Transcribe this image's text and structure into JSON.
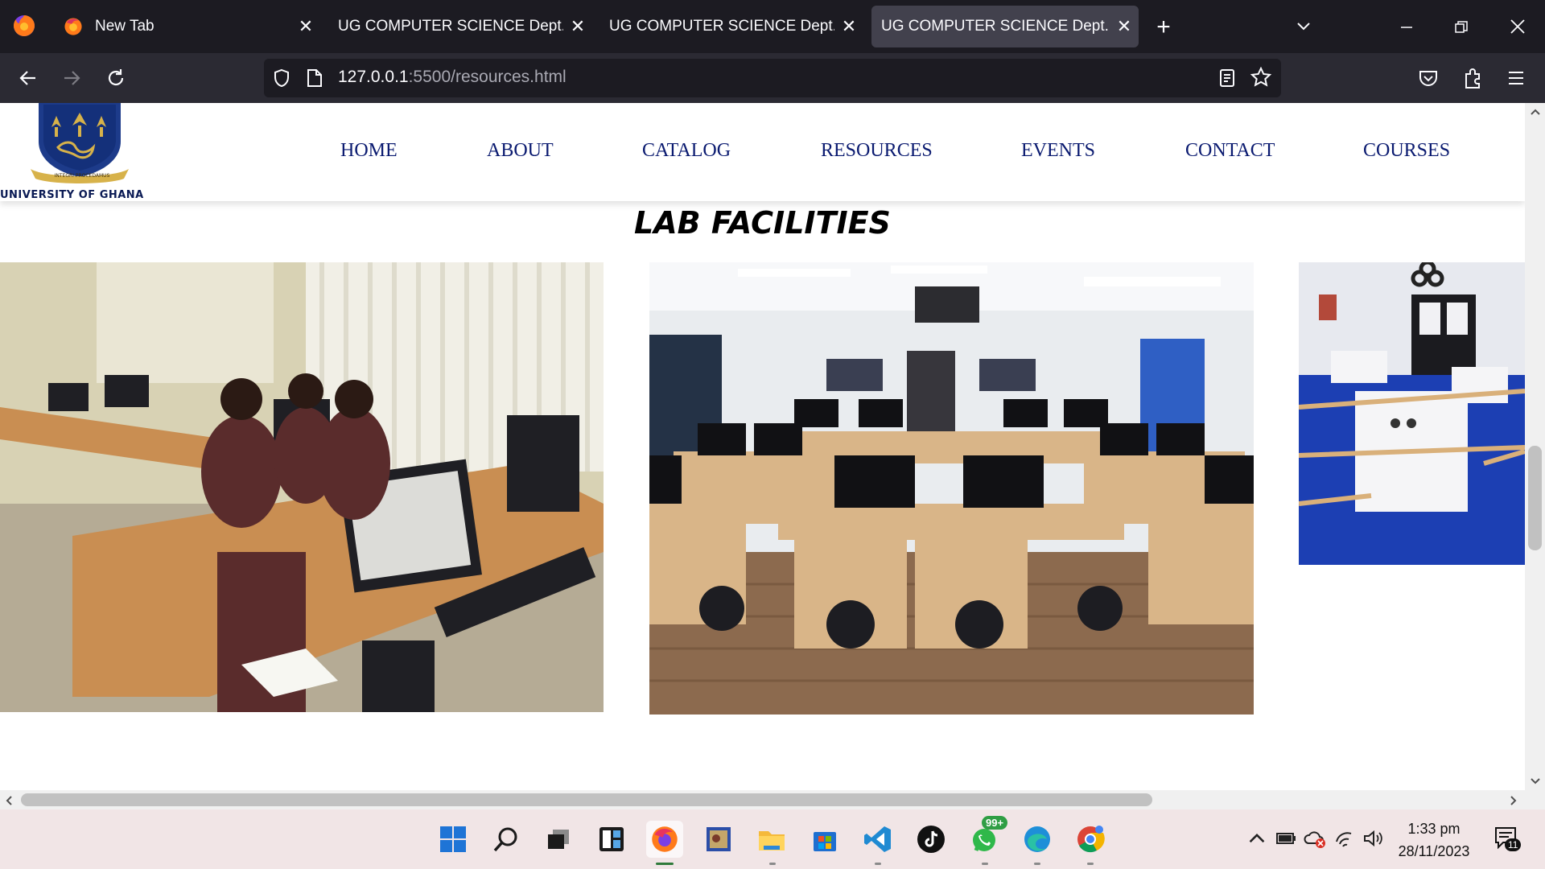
{
  "browser": {
    "tabs": [
      {
        "label": "New Tab",
        "active": false
      },
      {
        "label": "UG COMPUTER SCIENCE Dept.",
        "active": false
      },
      {
        "label": "UG COMPUTER SCIENCE Dept.",
        "active": false
      },
      {
        "label": "UG COMPUTER SCIENCE Dept.",
        "active": true
      }
    ],
    "url_host": "127.0.0.1",
    "url_rest": ":5500/resources.html"
  },
  "site": {
    "logo_text": "UNIVERSITY OF GHANA",
    "logo_motto": "INTEGRI PROCEDAMUS",
    "nav": [
      "HOME",
      "ABOUT",
      "CATALOG",
      "RESOURCES",
      "EVENTS",
      "CONTACT",
      "COURSES"
    ],
    "section_title": "LAB FACILITIES"
  },
  "taskbar": {
    "time": "1:33 pm",
    "date": "28/11/2023",
    "whatsapp_badge": "99+",
    "notification_count": "11"
  },
  "colors": {
    "nav_text": "#0a1a70",
    "chrome_bg": "#1c1b22",
    "toolbar_bg": "#2b2a33"
  }
}
